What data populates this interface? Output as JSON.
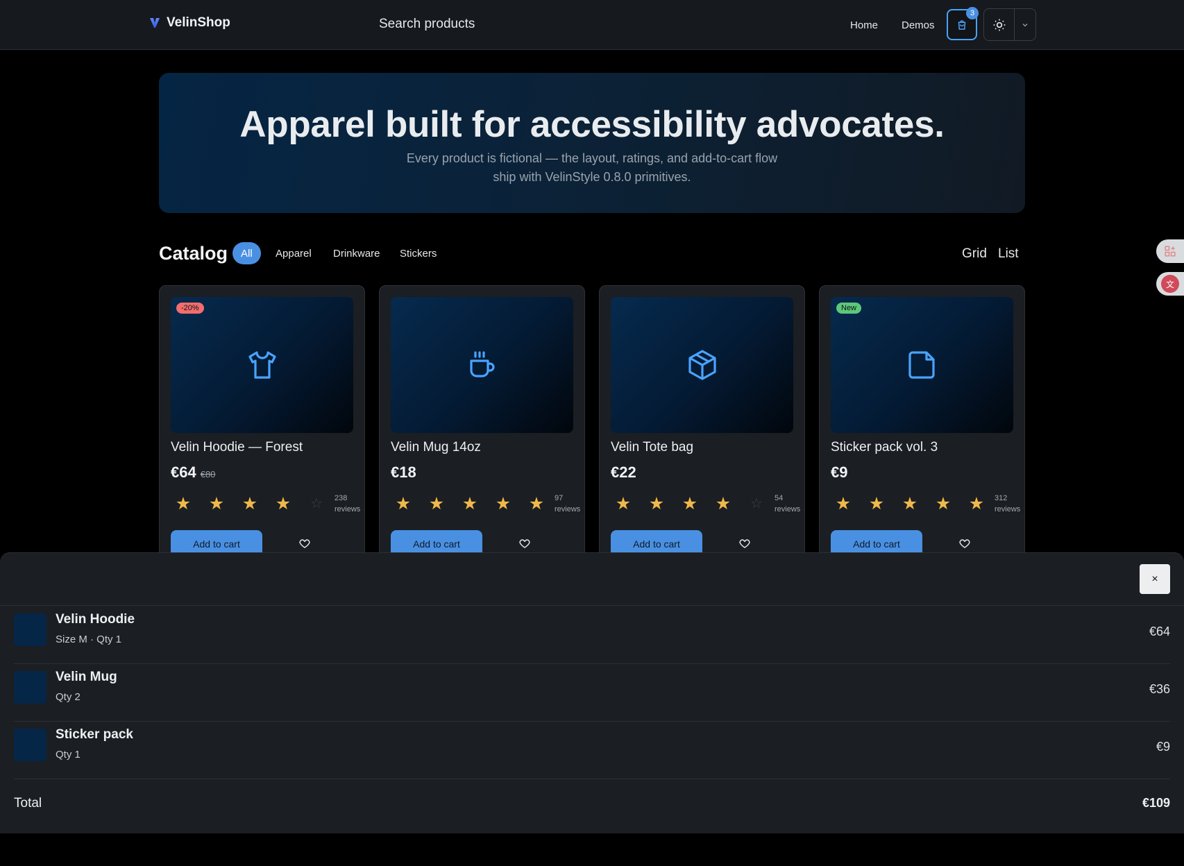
{
  "nav": {
    "brand": "VelinShop",
    "search_placeholder": "Search products",
    "links": [
      "Home",
      "Demos"
    ],
    "cart_count": "3"
  },
  "hero": {
    "title": "Apparel built for accessibility advocates.",
    "subtitle_line1": "Every product is fictional — the layout, ratings, and add-to-cart flow",
    "subtitle_line2": "ship with VelinStyle 0.8.0 primitives."
  },
  "catalog": {
    "title": "Catalog",
    "filters": [
      "All",
      "Apparel",
      "Drinkware",
      "Stickers"
    ],
    "active_filter": "All",
    "views": [
      "Grid",
      "List"
    ]
  },
  "products": [
    {
      "name": "Velin Hoodie — Forest",
      "price": "€64",
      "old_price": "€80",
      "badge": "-20%",
      "badge_color": "#f26d6d",
      "icon": "shirt-icon",
      "rating": 4,
      "reviews_count": "238",
      "reviews_label": "reviews",
      "add_label": "Add to cart"
    },
    {
      "name": "Velin Mug 14oz",
      "price": "€18",
      "old_price": "",
      "badge": "",
      "icon": "mug-icon",
      "rating": 5,
      "reviews_count": "97",
      "reviews_label": "reviews",
      "add_label": "Add to cart"
    },
    {
      "name": "Velin Tote bag",
      "price": "€22",
      "old_price": "",
      "badge": "",
      "icon": "box-icon",
      "rating": 4,
      "reviews_count": "54",
      "reviews_label": "reviews",
      "add_label": "Add to cart"
    },
    {
      "name": "Sticker pack vol. 3",
      "price": "€9",
      "old_price": "",
      "badge": "New",
      "badge_color": "#5cc87a",
      "icon": "sticker-icon",
      "rating": 5,
      "reviews_count": "312",
      "reviews_label": "reviews",
      "add_label": "Add to cart"
    }
  ],
  "cart": {
    "close_label": "×",
    "items": [
      {
        "name": "Velin Hoodie",
        "meta": "Size M · Qty 1",
        "price": "€64"
      },
      {
        "name": "Velin Mug",
        "meta": "Qty 2",
        "price": "€36"
      },
      {
        "name": "Sticker pack",
        "meta": "Qty 1",
        "price": "€9"
      }
    ],
    "total_label": "Total",
    "total_value": "€109"
  },
  "colors": {
    "accent": "#4a90e2",
    "star": "#f0b84a",
    "background": "#000000",
    "surface": "#1b1e22"
  }
}
